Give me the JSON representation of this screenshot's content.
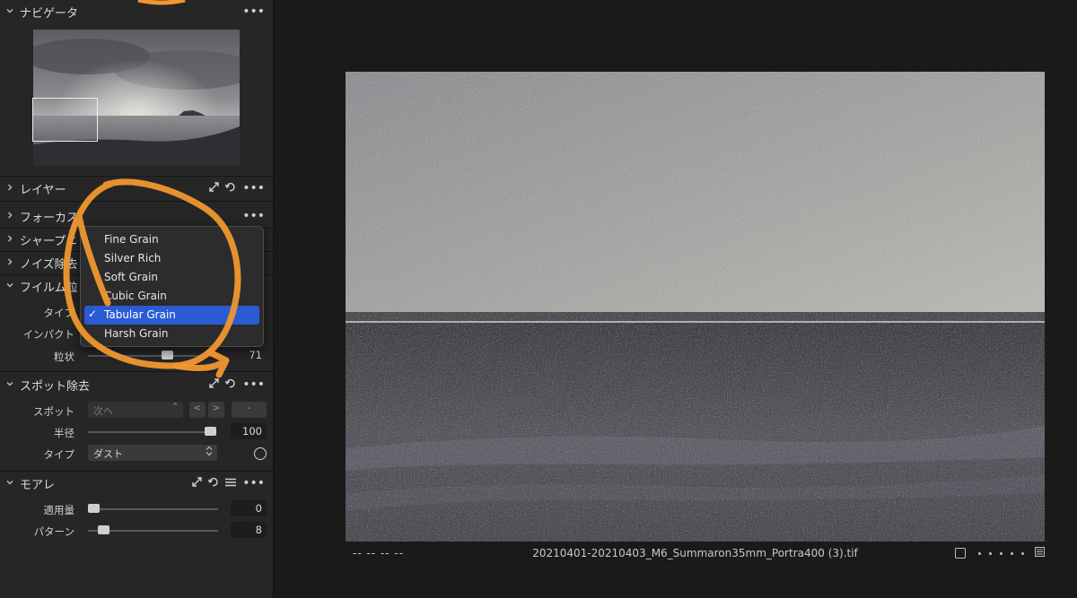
{
  "navigator": {
    "title": "ナビゲータ"
  },
  "sections": {
    "layers": "レイヤー",
    "focus": "フォーカス",
    "sharpen": "シャープニ",
    "noise": "ノイズ除去",
    "film_grain": "フイルム粒"
  },
  "film_grain": {
    "type_label": "タイプ",
    "impact_label": "インパクト",
    "granularity_label": "粒状",
    "granularity_value": "71",
    "granularity_level": 0.62
  },
  "grain_menu": {
    "options": [
      "Fine Grain",
      "Silver Rich",
      "Soft Grain",
      "Cubic Grain",
      "Tabular Grain",
      "Harsh Grain"
    ],
    "selected": "Tabular Grain",
    "check": "✓"
  },
  "spot_removal": {
    "title": "スポット除去",
    "spot_label": "スポット",
    "spot_select": "次へ",
    "prev": "<",
    "next": ">",
    "dash": "-",
    "radius_label": "半径",
    "radius_value": "100",
    "radius_level": 1.0,
    "type_label": "タイプ",
    "type_select": "ダスト"
  },
  "moire": {
    "title": "モアレ",
    "amount_label": "適用量",
    "amount_value": "0",
    "amount_level": 0.0,
    "pattern_label": "パターン",
    "pattern_value": "8",
    "pattern_level": 0.08
  },
  "viewer": {
    "left_status": "--   --   --   --",
    "filename": "20210401-20210403_M6_Summaron35mm_Portra400 (3).tif"
  },
  "icons": {
    "chevron_down": "⌄",
    "chevron_right": "›",
    "dots": "•••",
    "updown": "⌃⌄"
  },
  "colors": {
    "accent": "#2a5bd3",
    "annotation": "#f0972f"
  }
}
